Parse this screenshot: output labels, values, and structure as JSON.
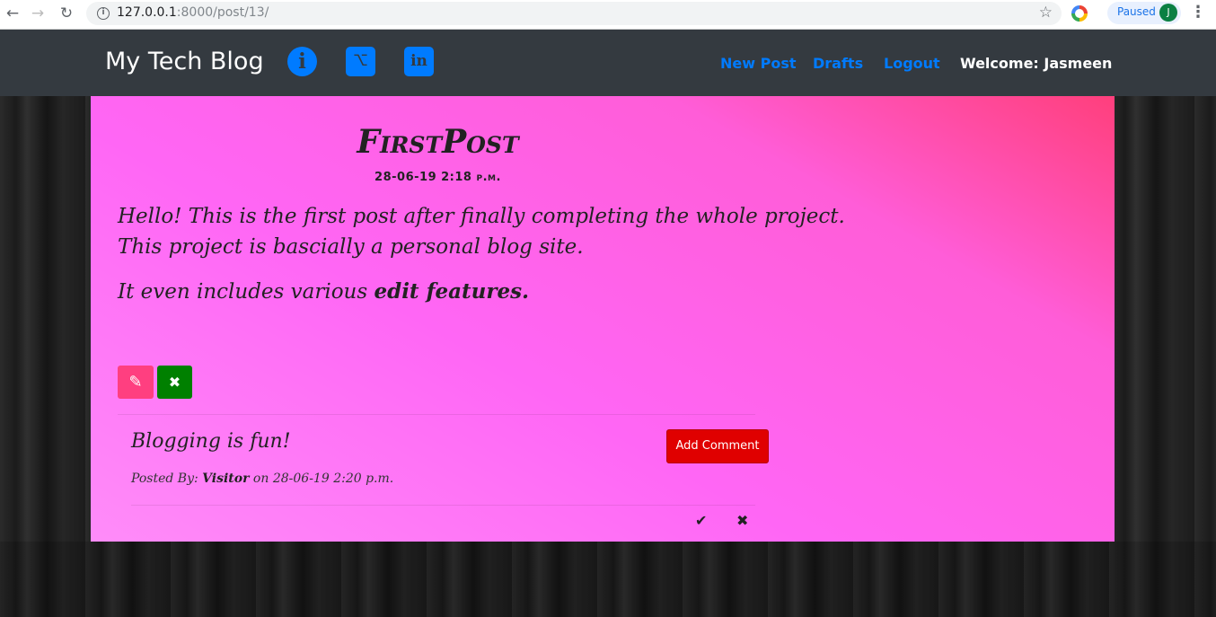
{
  "browser": {
    "url_host": "127.0.0.1",
    "url_path": ":8000/post/13/",
    "profile_status": "Paused",
    "profile_initial": "J"
  },
  "navbar": {
    "brand": "My Tech Blog",
    "links": [
      "New Post",
      "Drafts",
      "Logout"
    ],
    "welcome": "Welcome: Jasmeen",
    "link_color": "#007bff",
    "bg_color": "#343a40"
  },
  "post": {
    "title": "FirstPost",
    "date": "28-06-19 2:18 p.m.",
    "line1": "Hello! This is the first post after finally completing the whole project.",
    "line2": "This project is bascially a personal blog site.",
    "line3_prefix": "It even includes various ",
    "line3_bold": "edit features."
  },
  "comment": {
    "text": "Blogging is fun!",
    "posted_by_label": "Posted By: ",
    "author": "Visitor",
    "on_label": " on ",
    "timestamp": "28-06-19 2:20 p.m.",
    "add_comment_label": "Add Comment"
  },
  "icons": {
    "edit": "pencil-icon",
    "delete": "close-icon",
    "approve": "check-icon",
    "remove": "close-icon"
  },
  "colors": {
    "edit_button": "#ff3f80",
    "delete_button": "#008000",
    "add_comment_button": "#e00000"
  }
}
